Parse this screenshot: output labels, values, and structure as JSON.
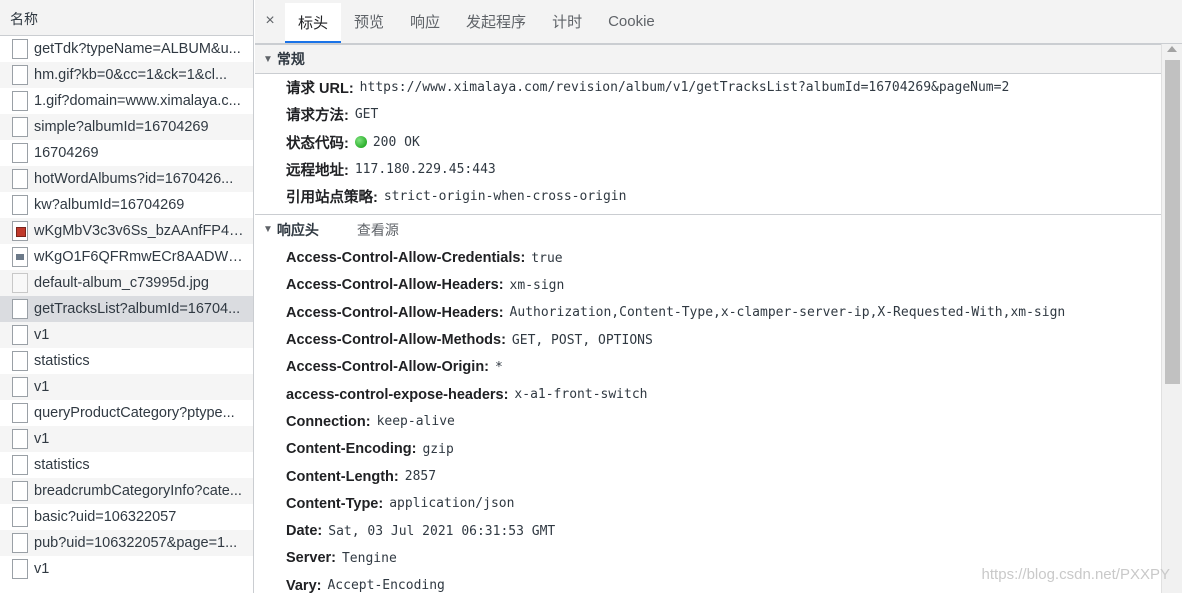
{
  "request_list": {
    "header": "名称",
    "items": [
      {
        "name": "getTdk?typeName=ALBUM&u...",
        "icon": "document-icon"
      },
      {
        "name": "hm.gif?kb=0&cc=1&ck=1&cl...",
        "icon": "document-icon"
      },
      {
        "name": "1.gif?domain=www.ximalaya.c...",
        "icon": "document-icon"
      },
      {
        "name": "simple?albumId=16704269",
        "icon": "document-icon"
      },
      {
        "name": "16704269",
        "icon": "document-icon"
      },
      {
        "name": "hotWordAlbums?id=1670426...",
        "icon": "document-icon"
      },
      {
        "name": "kw?albumId=16704269",
        "icon": "document-icon"
      },
      {
        "name": "wKgMbV3c3v6Ss_bzAAnfFP4a...",
        "icon": "image-icon"
      },
      {
        "name": "wKgO1F6QFRmwECr8AADWC...",
        "icon": "image-icon"
      },
      {
        "name": "default-album_c73995d.jpg",
        "icon": "image-icon"
      },
      {
        "name": "getTracksList?albumId=16704...",
        "icon": "document-icon"
      },
      {
        "name": "v1",
        "icon": "document-icon"
      },
      {
        "name": "statistics",
        "icon": "document-icon"
      },
      {
        "name": "v1",
        "icon": "document-icon"
      },
      {
        "name": "queryProductCategory?ptype...",
        "icon": "document-icon"
      },
      {
        "name": "v1",
        "icon": "document-icon"
      },
      {
        "name": "statistics",
        "icon": "document-icon"
      },
      {
        "name": "breadcrumbCategoryInfo?cate...",
        "icon": "document-icon"
      },
      {
        "name": "basic?uid=106322057",
        "icon": "document-icon"
      },
      {
        "name": "pub?uid=106322057&page=1...",
        "icon": "document-icon"
      },
      {
        "name": "v1",
        "icon": "document-icon"
      }
    ],
    "selected_index": 10
  },
  "tabs": {
    "close": "×",
    "items": [
      "标头",
      "预览",
      "响应",
      "发起程序",
      "计时",
      "Cookie"
    ],
    "active": 0
  },
  "general": {
    "title": "常规",
    "rows": [
      {
        "key": "请求 URL:",
        "value": "https://www.ximalaya.com/revision/album/v1/getTracksList?albumId=16704269&pageNum=2"
      },
      {
        "key": "请求方法:",
        "value": "GET"
      },
      {
        "key": "状态代码:",
        "value": "200 OK"
      },
      {
        "key": "远程地址:",
        "value": "117.180.229.45:443"
      },
      {
        "key": "引用站点策略:",
        "value": "strict-origin-when-cross-origin"
      }
    ]
  },
  "response_headers": {
    "title": "响应头",
    "view_source": "查看源",
    "rows": [
      {
        "key": "Access-Control-Allow-Credentials:",
        "value": "true"
      },
      {
        "key": "Access-Control-Allow-Headers:",
        "value": "xm-sign"
      },
      {
        "key": "Access-Control-Allow-Headers:",
        "value": "Authorization,Content-Type,x-clamper-server-ip,X-Requested-With,xm-sign"
      },
      {
        "key": "Access-Control-Allow-Methods:",
        "value": "GET, POST, OPTIONS"
      },
      {
        "key": "Access-Control-Allow-Origin:",
        "value": "*"
      },
      {
        "key": "access-control-expose-headers:",
        "value": "x-a1-front-switch"
      },
      {
        "key": "Connection:",
        "value": "keep-alive"
      },
      {
        "key": "Content-Encoding:",
        "value": "gzip"
      },
      {
        "key": "Content-Length:",
        "value": "2857"
      },
      {
        "key": "Content-Type:",
        "value": "application/json"
      },
      {
        "key": "Date:",
        "value": "Sat, 03 Jul 2021 06:31:53 GMT"
      },
      {
        "key": "Server:",
        "value": "Tengine"
      },
      {
        "key": "Vary:",
        "value": "Accept-Encoding"
      }
    ]
  },
  "watermark": "https://blog.csdn.net/PXXPY",
  "colors": {
    "accent": "#1a73e8",
    "status_ok": "#0a9a0a"
  }
}
